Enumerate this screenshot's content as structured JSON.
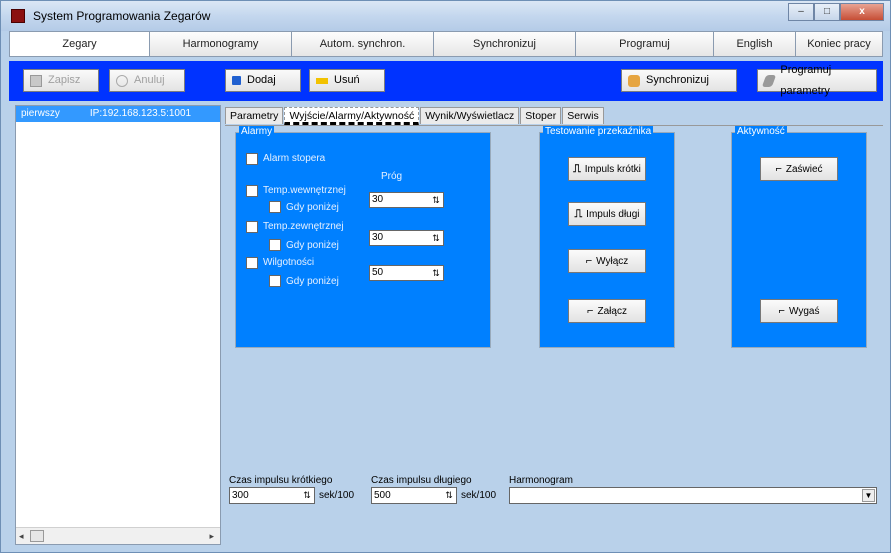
{
  "window": {
    "title": "System Programowania Zegarów",
    "caption_min": "–",
    "caption_max": "□",
    "caption_close": "x"
  },
  "menu": [
    "Zegary",
    "Harmonogramy",
    "Autom. synchron.",
    "Synchronizuj",
    "Programuj",
    "English",
    "Koniec pracy"
  ],
  "toolbar": {
    "save": "Zapisz",
    "cancel": "Anuluj",
    "add": "Dodaj",
    "remove": "Usuń",
    "sync": "Synchronizuj",
    "program": "Programuj parametry"
  },
  "clocks": [
    {
      "name": "pierwszy",
      "ip": "IP:192.168.123.5:1001"
    }
  ],
  "sidebar_scroll": {
    "left": "◂",
    "right": "▸"
  },
  "tabs": [
    "Parametry",
    "Wyjście/Alarmy/Aktywność",
    "Wynik/Wyświetlacz",
    "Stoper",
    "Serwis"
  ],
  "alarms": {
    "title": "Alarmy",
    "stopwatch": "Alarm stopera",
    "threshold": "Próg",
    "inner_temp": "Temp.wewnętrznej",
    "inner_below": "Gdy poniżej",
    "inner_value": "30",
    "outer_temp": "Temp.zewnętrznej",
    "outer_below": "Gdy poniżej",
    "outer_value": "30",
    "humidity": "Wilgotności",
    "humidity_below": "Gdy poniżej",
    "humidity_value": "50"
  },
  "relay": {
    "title": "Testowanie przekaźnika",
    "short": "Impuls krótki",
    "long": "Impuls długi",
    "off": "Wyłącz",
    "on": "Załącz"
  },
  "activity": {
    "title": "Aktywność",
    "on": "Zaświeć",
    "off": "Wygaś"
  },
  "bottom": {
    "short_label": "Czas impulsu krótkiego",
    "short_value": "300",
    "short_unit": "sek/100",
    "long_label": "Czas impulsu długiego",
    "long_value": "500",
    "long_unit": "sek/100",
    "schedule_label": "Harmonogram",
    "schedule_value": ""
  },
  "colors": {
    "toolbar": "#0033ff",
    "group": "#0080ff",
    "selection": "#3399ff",
    "background": "#b9d1ea"
  }
}
